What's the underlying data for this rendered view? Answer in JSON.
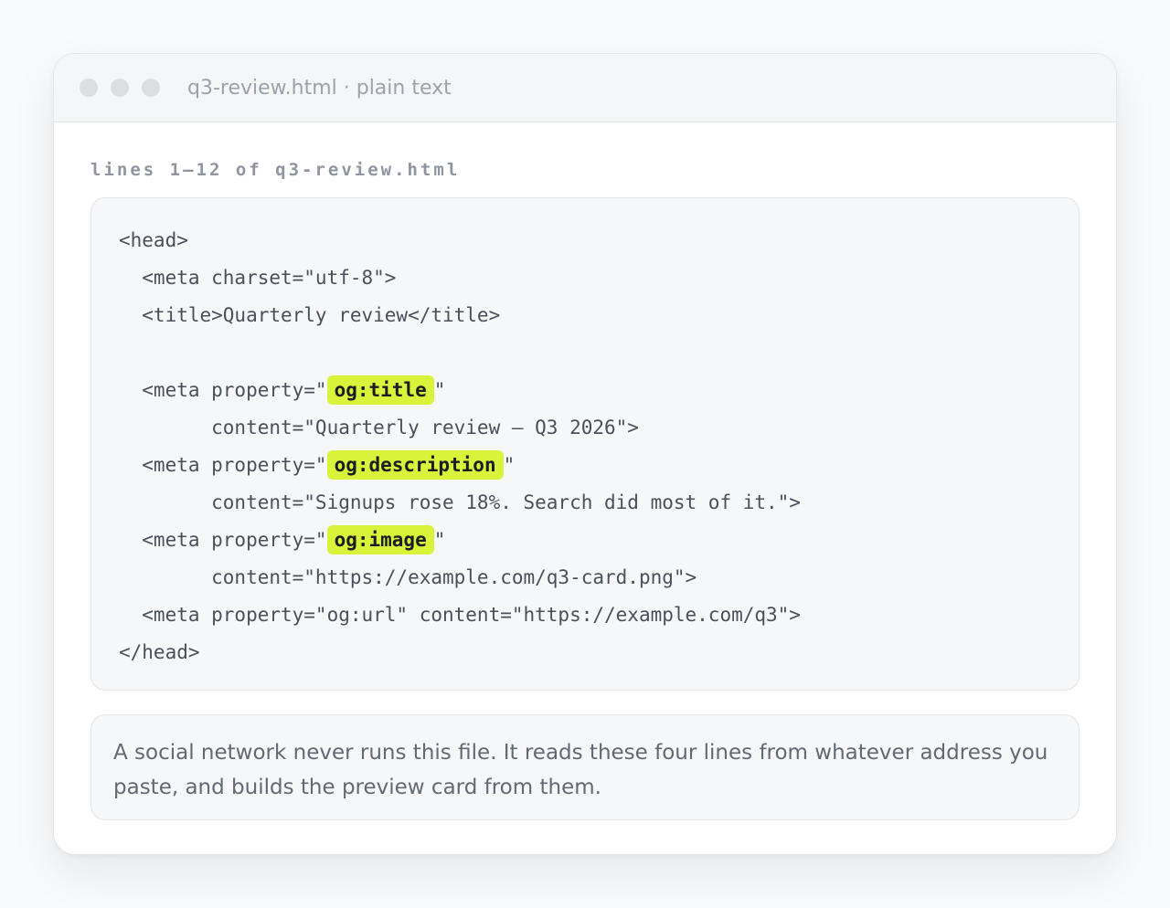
{
  "window": {
    "title": "q3-review.html · plain text"
  },
  "file_label": "lines 1–12 of q3-review.html",
  "code": {
    "line1": "<head>",
    "line2": "  <meta charset=\"utf-8\">",
    "line3": "  <title>Quarterly review</title>",
    "line5_prefix": "  <meta property=\"",
    "line5_hl": "og:title",
    "line5_suffix": "\"",
    "line6": "        content=\"Quarterly review — Q3 2026\">",
    "line7_prefix": "  <meta property=\"",
    "line7_hl": "og:description",
    "line7_suffix": "\"",
    "line8": "        content=\"Signups rose 18%. Search did most of it.\">",
    "line9_prefix": "  <meta property=\"",
    "line9_hl": "og:image",
    "line9_suffix": "\"",
    "line10": "        content=\"https://example.com/q3-card.png\">",
    "line11": "  <meta property=\"og:url\" content=\"https://example.com/q3\">",
    "line12": "</head>"
  },
  "note": "A social network never runs this file. It reads these four lines from whatever address you paste, and builds the preview card from them.",
  "colors": {
    "highlight": "#d9f23a",
    "code_text": "#4a5059",
    "background": "#f9fafb"
  }
}
